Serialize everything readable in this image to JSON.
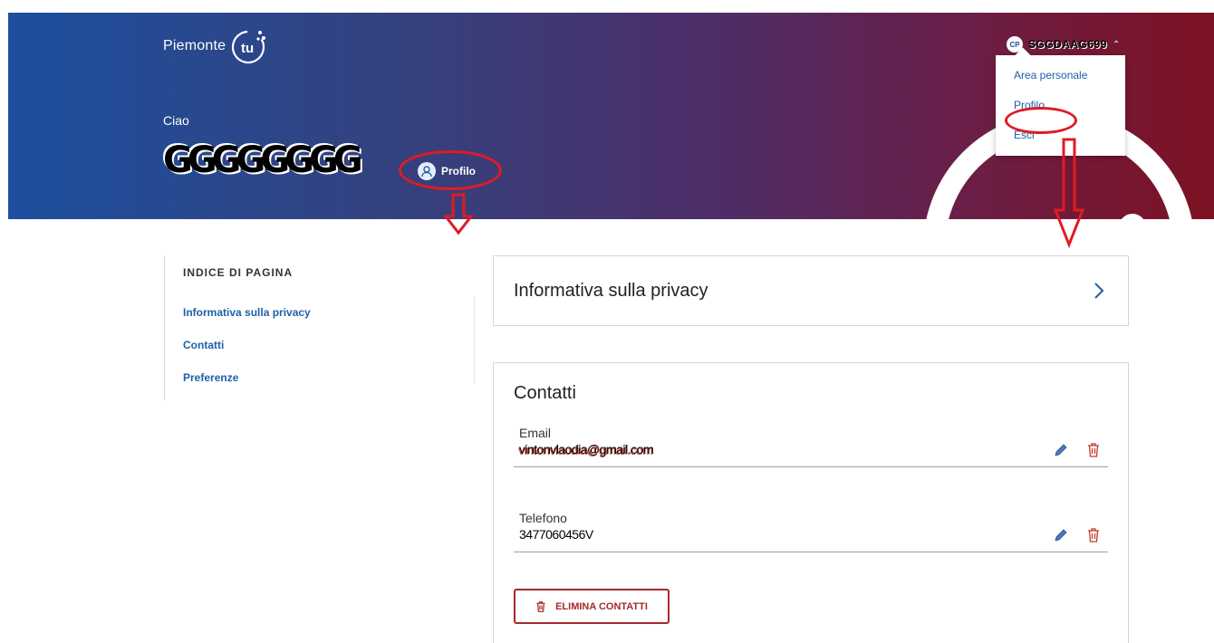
{
  "header": {
    "logo_text": "Piemonte",
    "logo_mark_text": "tu",
    "greeting": "Ciao",
    "user_name": "GGGGGGGG",
    "profile_button_label": "Profilo",
    "user_badge": "CP",
    "user_code": "SGGDAAG699"
  },
  "user_menu": {
    "items": [
      {
        "label": "Area personale"
      },
      {
        "label": "Profilo"
      },
      {
        "label": "Esci"
      }
    ]
  },
  "page_index": {
    "title": "INDICE DI PAGINA",
    "links": [
      {
        "label": "Informativa sulla privacy"
      },
      {
        "label": "Contatti"
      },
      {
        "label": "Preferenze"
      }
    ]
  },
  "privacy_card": {
    "title": "Informativa sulla privacy"
  },
  "contacts_card": {
    "title": "Contatti",
    "email_label": "Email",
    "email_value": "vintonvlaodia@gmail.com",
    "phone_label": "Telefono",
    "phone_value": "3477060456V",
    "delete_button_label": "ELIMINA CONTATTI"
  },
  "colors": {
    "accent_blue": "#1f5fa8",
    "annotation_red": "#e01b22",
    "danger": "#a52a2a"
  },
  "icons": [
    "piemonte-tu-logo-icon",
    "user-avatar-icon",
    "chevron-up-icon",
    "chevron-right-icon",
    "pencil-icon",
    "trash-icon"
  ]
}
